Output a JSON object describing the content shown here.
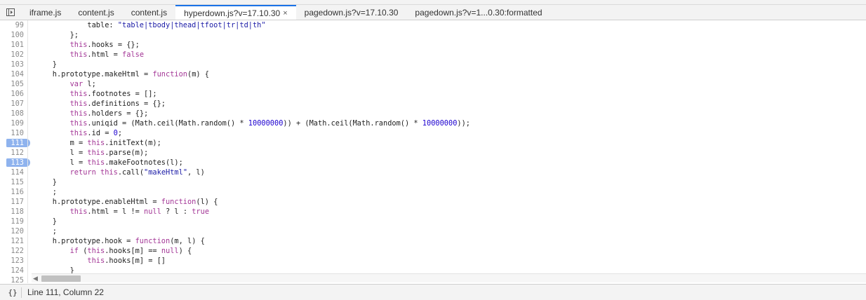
{
  "tabs": [
    {
      "label": "iframe.js",
      "active": false,
      "closable": false
    },
    {
      "label": "content.js",
      "active": false,
      "closable": false
    },
    {
      "label": "content.js",
      "active": false,
      "closable": false
    },
    {
      "label": "hyperdown.js?v=17.10.30",
      "active": true,
      "closable": true
    },
    {
      "label": "pagedown.js?v=17.10.30",
      "active": false,
      "closable": false
    },
    {
      "label": "pagedown.js?v=1...0.30:formatted",
      "active": false,
      "closable": false
    }
  ],
  "close_glyph": "×",
  "code_lines": [
    {
      "n": "99",
      "bp": false,
      "text": "            table: \"table|tbody|thead|tfoot|tr|td|th\""
    },
    {
      "n": "100",
      "bp": false,
      "text": "        };"
    },
    {
      "n": "101",
      "bp": false,
      "text": "        this.hooks = {};"
    },
    {
      "n": "102",
      "bp": false,
      "text": "        this.html = false"
    },
    {
      "n": "103",
      "bp": false,
      "text": "    }"
    },
    {
      "n": "104",
      "bp": false,
      "text": "    h.prototype.makeHtml = function(m) {"
    },
    {
      "n": "105",
      "bp": false,
      "text": "        var l;"
    },
    {
      "n": "106",
      "bp": false,
      "text": "        this.footnotes = [];"
    },
    {
      "n": "107",
      "bp": false,
      "text": "        this.definitions = {};"
    },
    {
      "n": "108",
      "bp": false,
      "text": "        this.holders = {};"
    },
    {
      "n": "109",
      "bp": false,
      "text": "        this.uniqid = (Math.ceil(Math.random() * 10000000)) + (Math.ceil(Math.random() * 10000000));"
    },
    {
      "n": "110",
      "bp": false,
      "text": "        this.id = 0;"
    },
    {
      "n": "111",
      "bp": true,
      "text": "        m = this.initText(m);"
    },
    {
      "n": "112",
      "bp": false,
      "text": "        l = this.parse(m);"
    },
    {
      "n": "113",
      "bp": true,
      "text": "        l = this.makeFootnotes(l);"
    },
    {
      "n": "114",
      "bp": false,
      "text": "        return this.call(\"makeHtml\", l)"
    },
    {
      "n": "115",
      "bp": false,
      "text": "    }"
    },
    {
      "n": "116",
      "bp": false,
      "text": "    ;"
    },
    {
      "n": "117",
      "bp": false,
      "text": "    h.prototype.enableHtml = function(l) {"
    },
    {
      "n": "118",
      "bp": false,
      "text": "        this.html = l != null ? l : true"
    },
    {
      "n": "119",
      "bp": false,
      "text": "    }"
    },
    {
      "n": "120",
      "bp": false,
      "text": "    ;"
    },
    {
      "n": "121",
      "bp": false,
      "text": "    h.prototype.hook = function(m, l) {"
    },
    {
      "n": "122",
      "bp": false,
      "text": "        if (this.hooks[m] == null) {"
    },
    {
      "n": "123",
      "bp": false,
      "text": "            this.hooks[m] = []"
    },
    {
      "n": "124",
      "bp": false,
      "text": "        }"
    },
    {
      "n": "125",
      "bp": false,
      "text": ""
    }
  ],
  "status": {
    "pretty_print_icon": "{}",
    "cursor_position": "Line 111, Column 22"
  }
}
